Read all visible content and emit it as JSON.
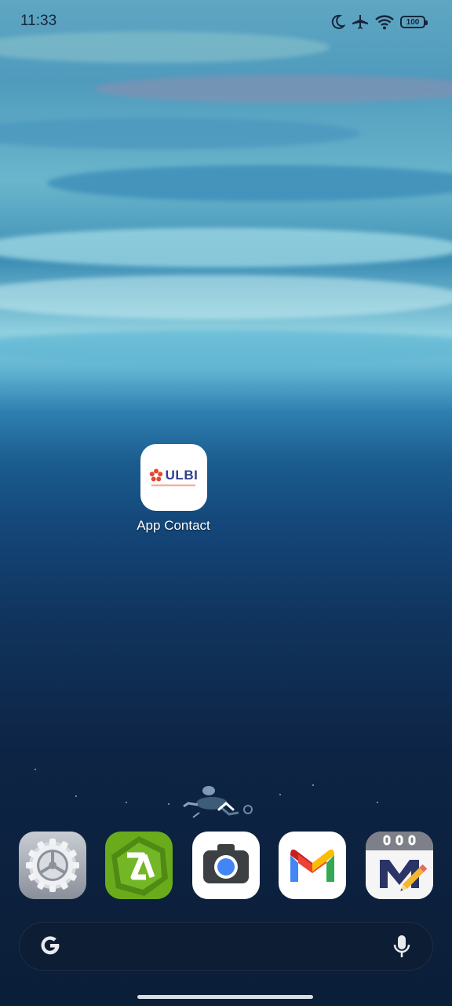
{
  "status_bar": {
    "time": "11:33",
    "battery": "100",
    "icons": [
      "moon-icon",
      "airplane-icon",
      "wifi-icon",
      "battery-icon"
    ]
  },
  "home": {
    "apps": [
      {
        "label": "App Contact",
        "icon": "ulbi-logo",
        "logo_text": "ULBI"
      }
    ]
  },
  "dock": {
    "apps": [
      "settings",
      "zarchiver",
      "camera",
      "gmail",
      "notes"
    ]
  },
  "search": {
    "icons": [
      "google-icon",
      "mic-icon"
    ]
  },
  "colors": {
    "ulbi_blue": "#2c3f8f",
    "ulbi_red": "#e5482b",
    "zarchiver_green": "#6aab1c"
  }
}
